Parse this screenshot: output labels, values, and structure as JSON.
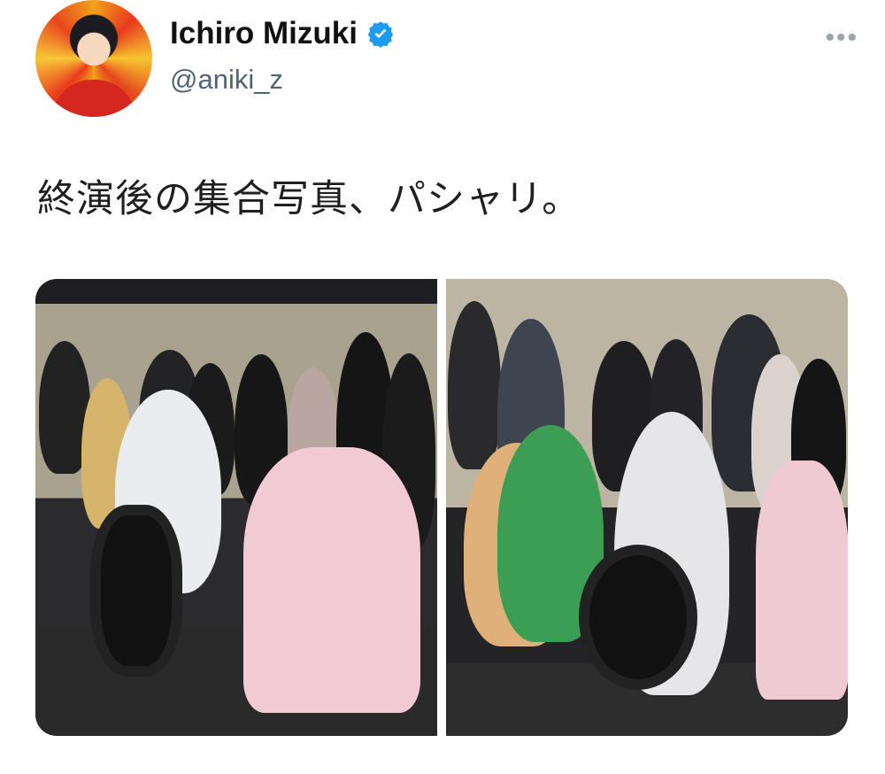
{
  "user": {
    "name": "Ichiro Mizuki",
    "handle": "@aniki_z",
    "verified": true,
    "verified_icon_color": "#1d9bf0"
  },
  "more_icon_text": "•••",
  "tweet": {
    "text": "終演後の集合写真、パシャリ。"
  },
  "media": {
    "photos": [
      {
        "alt": ""
      },
      {
        "alt": ""
      }
    ]
  }
}
